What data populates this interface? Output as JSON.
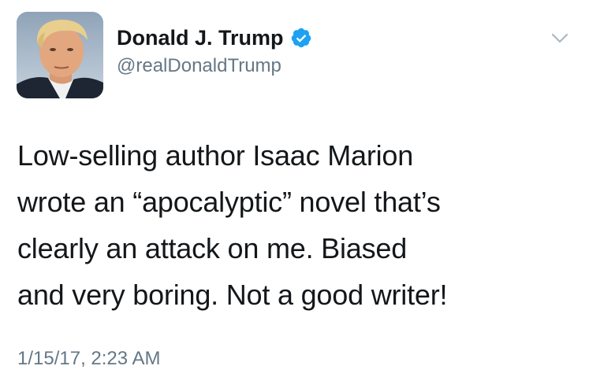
{
  "tweet": {
    "display_name": "Donald J. Trump",
    "handle": "@realDonaldTrump",
    "verified": true,
    "verified_icon": "verified-badge-icon",
    "menu_icon": "chevron-down-icon",
    "text": "Low-selling author Isaac Marion\nwrote an “apocalyptic” novel that’s\nclearly an attack on me. Biased\nand very boring. Not a good writer!",
    "timestamp": "1/15/17, 2:23 AM"
  },
  "colors": {
    "text": "#14171a",
    "secondary_text": "#657786",
    "verified_blue": "#1da1f2",
    "chevron": "#aab8c2"
  }
}
